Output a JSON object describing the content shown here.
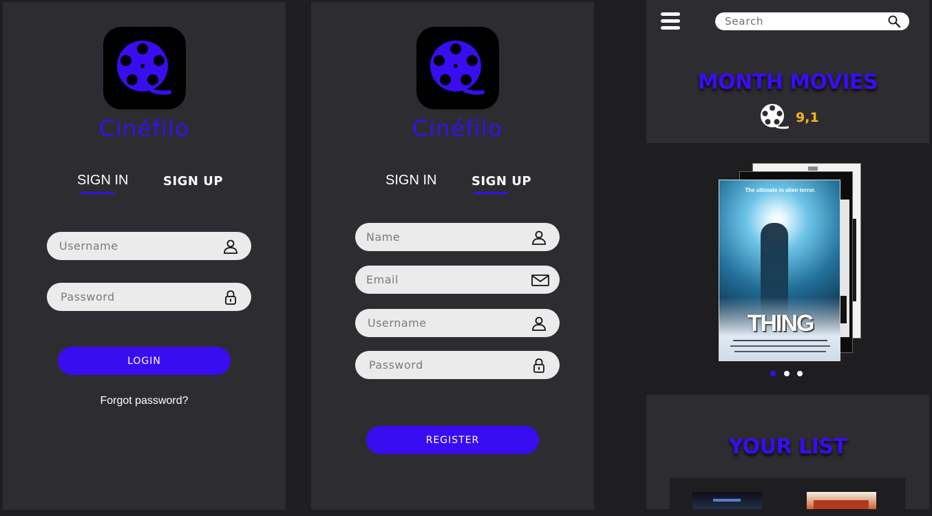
{
  "colors": {
    "accent": "#3a0df0",
    "rating": "#f5b71b",
    "panel": "#2d2d31",
    "background": "#1e1e20",
    "field": "#ebebeb"
  },
  "login_screen": {
    "brand": "Cinéfilo",
    "tabs": [
      {
        "label": "SIGN IN",
        "active": true
      },
      {
        "label": "SIGN UP",
        "active": false
      }
    ],
    "username_placeholder": "Username",
    "password_placeholder": "Password",
    "login_label": "LOGIN",
    "forgot_label": "Forgot password?",
    "icons": {
      "username": "user-icon",
      "password": "lock-icon",
      "logo": "film-reel-icon"
    }
  },
  "register_screen": {
    "brand": "Cinéfilo",
    "tabs": [
      {
        "label": "SIGN IN",
        "active": false
      },
      {
        "label": "SIGN UP",
        "active": true
      }
    ],
    "name_placeholder": "Name",
    "email_placeholder": "Email",
    "username_placeholder": "Username",
    "password_placeholder": "Password",
    "register_label": "REGISTER",
    "icons": {
      "name": "user-icon",
      "email": "envelope-icon",
      "username": "user-icon",
      "password": "lock-icon"
    }
  },
  "home_screen": {
    "search_placeholder": "Search",
    "month_heading": "MONTH MOVIES",
    "rating": "9,1",
    "poster": {
      "tagline": "The ultimate in alien terror.",
      "title": "THING"
    },
    "carousel": {
      "slides": 3,
      "active": 1
    },
    "list_heading": "YOUR LIST",
    "icons": {
      "menu": "hamburger-menu-icon",
      "search": "search-icon",
      "rating": "film-reel-icon"
    }
  }
}
